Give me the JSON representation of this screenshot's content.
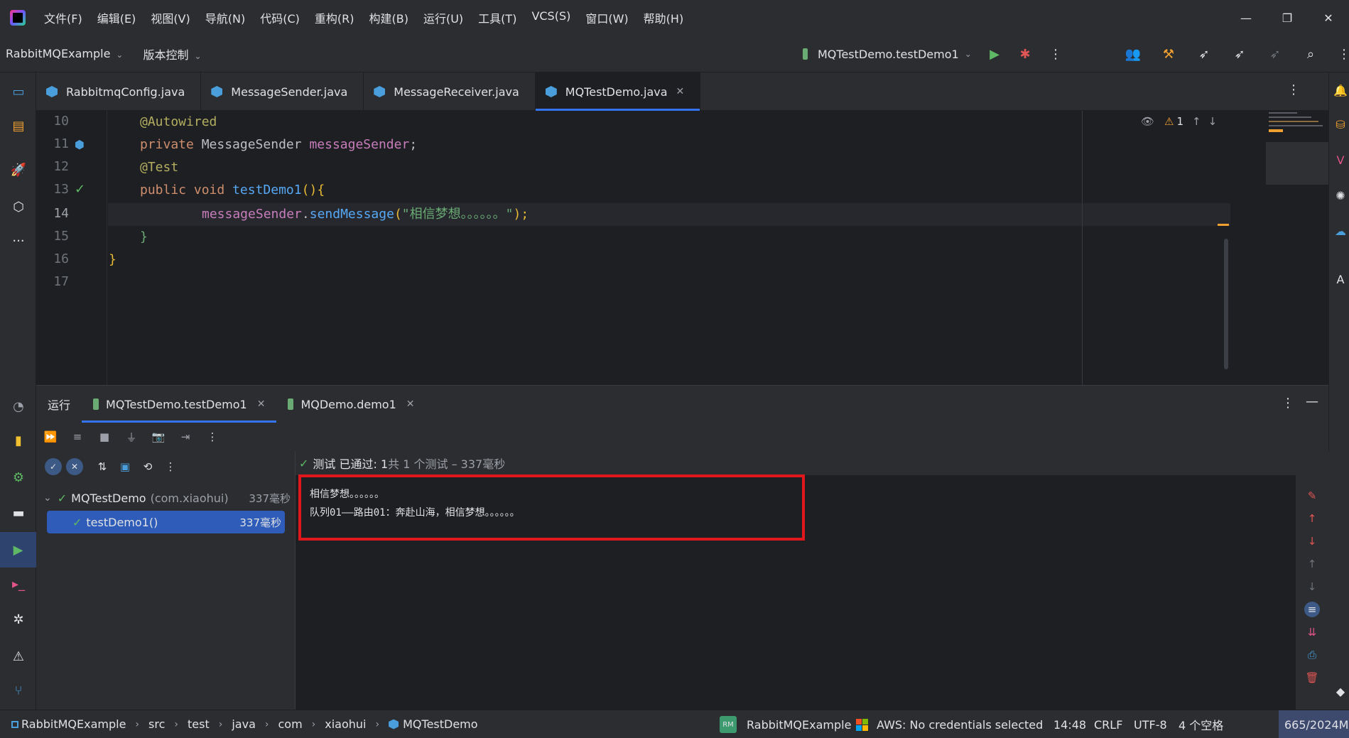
{
  "menu": [
    "文件(F)",
    "编辑(E)",
    "视图(V)",
    "导航(N)",
    "代码(C)",
    "重构(R)",
    "构建(B)",
    "运行(U)",
    "工具(T)",
    "VCS(S)",
    "窗口(W)",
    "帮助(H)"
  ],
  "toolbar": {
    "project": "RabbitMQExample",
    "vcs": "版本控制",
    "run_config": "MQTestDemo.testDemo1"
  },
  "editor_tabs": [
    {
      "label": "RabbitmqConfig.java",
      "active": false
    },
    {
      "label": "MessageSender.java",
      "active": false
    },
    {
      "label": "MessageReceiver.java",
      "active": false
    },
    {
      "label": "MQTestDemo.java",
      "active": true
    }
  ],
  "editor": {
    "line_numbers": [
      "10",
      "11",
      "12",
      "13",
      "14",
      "15",
      "16",
      "17"
    ],
    "lines": {
      "l10": {
        "annot": "@Autowired"
      },
      "l11": {
        "kw": "private",
        "type": "MessageSender",
        "field": "messageSender",
        "end": ";"
      },
      "l12": {
        "annot": "@Test"
      },
      "l13": {
        "kw1": "public",
        "kw2": "void",
        "method": "testDemo1",
        "parens": "()",
        "brace": "{"
      },
      "l14": {
        "field": "messageSender",
        "dot": ".",
        "method": "sendMessage",
        "open": "(",
        "string": "\"相信梦想。。。。。。\"",
        "close": ");"
      },
      "l15": {
        "brace": "}"
      },
      "l16": {
        "brace": "}"
      }
    },
    "inspection_count": "1"
  },
  "run_panel": {
    "title": "运行",
    "tabs": [
      {
        "label": "MQTestDemo.testDemo1",
        "active": true
      },
      {
        "label": "MQDemo.demo1",
        "active": false
      }
    ],
    "tree": [
      {
        "name": "MQTestDemo",
        "package": "(com.xiaohui)",
        "duration": "337毫秒"
      },
      {
        "name": "testDemo1()",
        "duration": "337毫秒"
      }
    ],
    "status_prefix": "测试 已通过: 1",
    "status_suffix": "共 1 个测试 – 337毫秒",
    "console_lines": [
      "相信梦想。。。。。。",
      "队列01——路由01：奔赴山海，相信梦想。。。。。。"
    ]
  },
  "statusbar": {
    "breadcrumbs": [
      "RabbitMQExample",
      "src",
      "test",
      "java",
      "com",
      "xiaohui",
      "MQTestDemo"
    ],
    "plugin_badge": "RM",
    "plugin_project": "RabbitMQExample",
    "aws": "AWS: No credentials selected",
    "position": "14:48",
    "line_sep": "CRLF",
    "encoding": "UTF-8",
    "indent": "4 个空格",
    "memory": "665/2024M"
  }
}
